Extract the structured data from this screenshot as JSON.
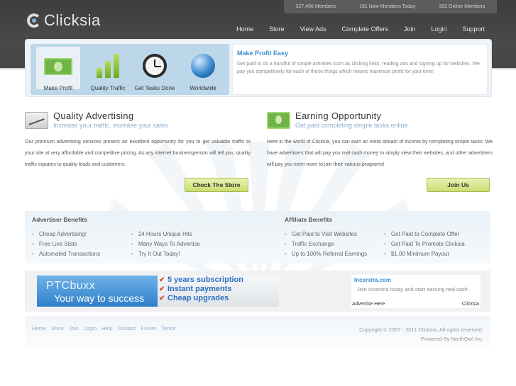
{
  "header": {
    "logo_text": "Clicksia",
    "stats": [
      "327,466 Members",
      "161 New Members Today",
      "392 Online Members"
    ],
    "nav": [
      "Home",
      "Store",
      "View Ads",
      "Complete Offers",
      "Join",
      "Login",
      "Support"
    ]
  },
  "feature": {
    "items": [
      {
        "label": "Make Profit",
        "icon": "money-icon"
      },
      {
        "label": "Quality Traffic",
        "icon": "bar-chart-icon"
      },
      {
        "label": "Get Tasks Done",
        "icon": "clock-icon"
      },
      {
        "label": "Worldwide",
        "icon": "globe-icon"
      }
    ],
    "panel_title": "Make Profit Easy",
    "panel_text": "Get paid to do a handful of simple activities such as clicking links, reading ads and signing up for websites. We pay you competitively for each of these things which means maximum profit for your time!"
  },
  "left_col": {
    "title": "Quality Advertising",
    "subtitle": "Increase your traffic, increase your sales",
    "body": "Our premium advertising services present an excellent opportunity for you to get valuable traffic to your site at very affordable and competitive pricing. As any internet businessperson will tell you, quality traffic equates to quality leads and customers.",
    "button": "Check The Store"
  },
  "right_col": {
    "title": "Earning Opportunity",
    "subtitle": "Get paid completing simple tasks online",
    "body": "Here in the world of Clicksia, you can earn an extra stream of income by completing simple tasks; We have advertisers that will pay you real cash money to simply view their websites, and other advertisers will pay you even more to join their various programs!",
    "button": "Join Us"
  },
  "advertiser_benefits": {
    "title": "Advertiser Benefits",
    "col1": [
      "Cheap Advertising!",
      "Free Live Stats",
      "Automated Transactions"
    ],
    "col2": [
      "24 Hours Unique Hits",
      "Many Ways To Advertise",
      "Try It Out Today!"
    ]
  },
  "affiliate_benefits": {
    "title": "Affiliate Benefits",
    "col1": [
      "Get Paid to Visit Websites",
      "Traffic Exchange",
      "Up to 100% Referral Earnings"
    ],
    "col2": [
      "Get Paid to Complete Offer",
      "Get Paid To Promote Clicksia",
      "$1.00 Minimum Payout"
    ]
  },
  "banner": {
    "brand": "PTCbuxx",
    "tagline": "Your way to success",
    "points": [
      "5 years subscription",
      "Instant payments",
      "Cheap upgrades"
    ]
  },
  "text_ad": {
    "title": "Incentria.com",
    "desc": "Join Incentria today and start earning real cash",
    "advertise": "Advertise Here",
    "brand": "Clicksia"
  },
  "footer": {
    "links": [
      "Home",
      "Store",
      "Join",
      "Login",
      "Help",
      "Contact",
      "Forum",
      "Terms"
    ],
    "copyright": "Copyright © 2007 - 2011 Clicksia, All rights reserved.",
    "powered": "Powered By NorthOwl Inc."
  }
}
